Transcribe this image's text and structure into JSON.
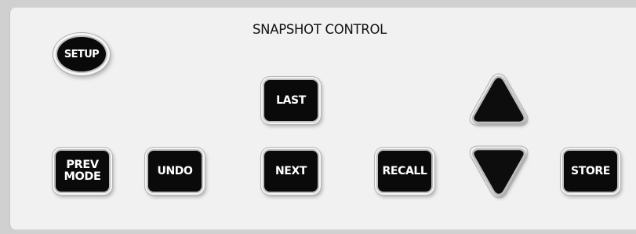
{
  "panel": {
    "title": "SNAPSHOT CONTROL"
  },
  "buttons": {
    "setup": "SETUP",
    "last": "LAST",
    "prev_mode_line1": "PREV",
    "prev_mode_line2": "MODE",
    "undo": "UNDO",
    "next": "NEXT",
    "recall": "RECALL",
    "store": "STORE"
  },
  "icons": {
    "up": "up-triangle-icon",
    "down": "down-triangle-icon"
  },
  "colors": {
    "panel_bg": "#f1f1f1",
    "button_fill": "#0a0a0a",
    "button_text": "#ffffff",
    "title_text": "#111111"
  }
}
